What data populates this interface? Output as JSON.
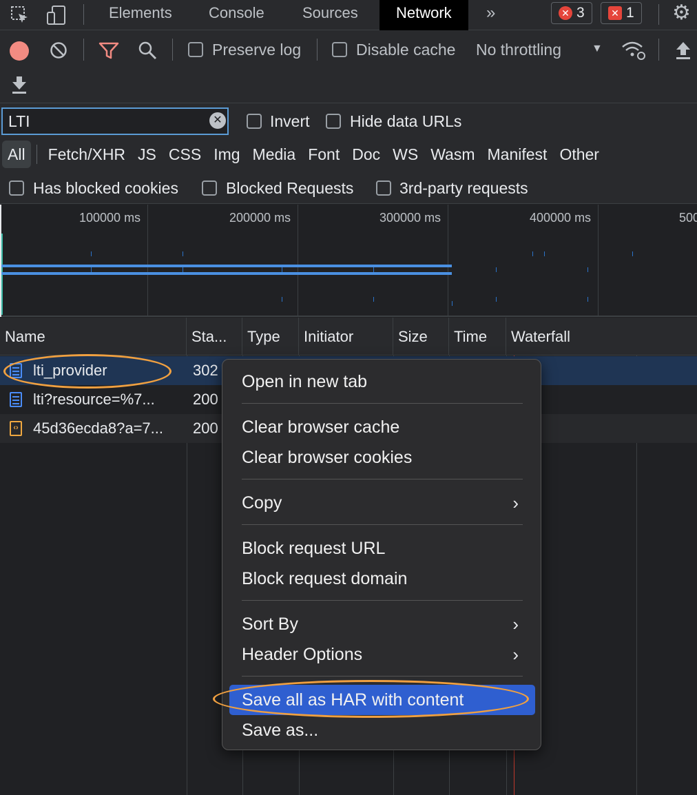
{
  "tabs": {
    "elements": "Elements",
    "console": "Console",
    "sources": "Sources",
    "network": "Network",
    "more": "»",
    "error_count": "3",
    "issue_count": "1"
  },
  "toolbar": {
    "preserve_log": "Preserve log",
    "disable_cache": "Disable cache",
    "throttling": "No throttling",
    "dropdown_arrow": "▼"
  },
  "filter": {
    "value": "LTI",
    "invert": "Invert",
    "hide_data_urls": "Hide data URLs",
    "types": [
      "All",
      "Fetch/XHR",
      "JS",
      "CSS",
      "Img",
      "Media",
      "Font",
      "Doc",
      "WS",
      "Wasm",
      "Manifest",
      "Other"
    ],
    "has_blocked_cookies": "Has blocked cookies",
    "blocked_requests": "Blocked Requests",
    "third_party": "3rd-party requests"
  },
  "overview": {
    "ticks": [
      "100000 ms",
      "200000 ms",
      "300000 ms",
      "400000 ms",
      "500"
    ]
  },
  "table": {
    "headers": {
      "name": "Name",
      "status": "Sta...",
      "type": "Type",
      "initiator": "Initiator",
      "size": "Size",
      "time": "Time",
      "waterfall": "Waterfall"
    },
    "rows": [
      {
        "name": "lti_provider",
        "status": "302"
      },
      {
        "name": "lti?resource=%7...",
        "status": "200"
      },
      {
        "name": "45d36ecda8?a=7...",
        "status": "200"
      }
    ]
  },
  "context_menu": {
    "open_new_tab": "Open in new tab",
    "clear_cache": "Clear browser cache",
    "clear_cookies": "Clear browser cookies",
    "copy": "Copy",
    "block_url": "Block request URL",
    "block_domain": "Block request domain",
    "sort_by": "Sort By",
    "header_options": "Header Options",
    "save_har": "Save all as HAR with content",
    "save_as": "Save as...",
    "submenu_arrow": "›"
  },
  "colors": {
    "accent_highlight": "#2f5fd0",
    "annotation": "#f0a040",
    "record": "#f28b82",
    "error": "#e5453b"
  }
}
